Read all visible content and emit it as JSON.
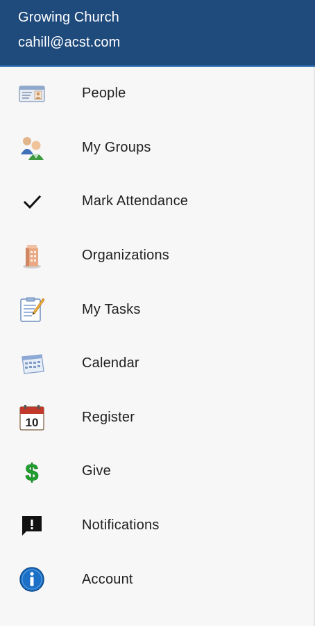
{
  "header": {
    "organization": "Growing Church",
    "email": "cahill@acst.com"
  },
  "menu": {
    "items": [
      {
        "label": "People",
        "icon": "id-card-icon"
      },
      {
        "label": "My Groups",
        "icon": "users-icon"
      },
      {
        "label": "Mark Attendance",
        "icon": "checkmark-icon"
      },
      {
        "label": "Organizations",
        "icon": "building-icon"
      },
      {
        "label": "My Tasks",
        "icon": "task-list-icon"
      },
      {
        "label": "Calendar",
        "icon": "calendar-icon"
      },
      {
        "label": "Register",
        "icon": "calendar-date-icon"
      },
      {
        "label": "Give",
        "icon": "dollar-icon"
      },
      {
        "label": "Notifications",
        "icon": "alert-message-icon"
      },
      {
        "label": "Account",
        "icon": "info-icon"
      }
    ]
  },
  "colors": {
    "header_bg": "#1f4a7c",
    "header_text": "#ffffff",
    "menu_bg": "#f7f7f8",
    "label_text": "#202020",
    "give_green": "#1fa22e",
    "info_blue": "#1b6fc4"
  }
}
